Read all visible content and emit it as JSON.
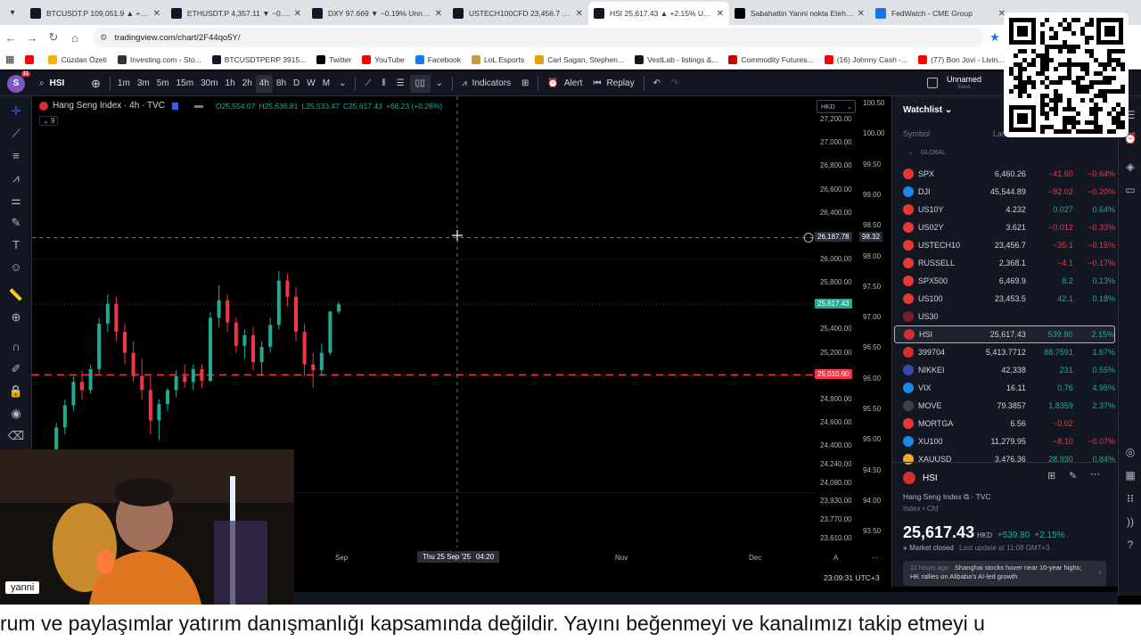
{
  "browser": {
    "tabs": [
      {
        "title": "BTCUSDT.P 109,051.9 ▲ +0.78%",
        "fav_color": "#131722",
        "active": false
      },
      {
        "title": "ETHUSDT.P 4,357.11 ▼ −0.74%",
        "fav_color": "#131722",
        "active": false
      },
      {
        "title": "DXY 97.669 ▼ −0.19% Unnamed",
        "fav_color": "#131722",
        "active": false
      },
      {
        "title": "USTECH100CFD 23,456.7 ▼ −0",
        "fav_color": "#131722",
        "active": false
      },
      {
        "title": "HSI 25,617.43 ▲ +2.15% Unnamed",
        "fav_color": "#131722",
        "active": true
      },
      {
        "title": "Sabahattin Yanni nokta Etehe (",
        "fav_color": "#000000",
        "active": false
      },
      {
        "title": "FedWatch - CME Group",
        "fav_color": "#1a73e8",
        "active": false
      }
    ],
    "url": "tradingview.com/chart/2F44qo5Y/",
    "bookmarks": [
      {
        "label": "",
        "color": "#ff0000"
      },
      {
        "label": "Cüzdan Özeti",
        "color": "#f4b400"
      },
      {
        "label": "Investing.com - Sto...",
        "color": "#333333"
      },
      {
        "label": "BTCUSDTPERP 3915...",
        "color": "#131722"
      },
      {
        "label": "Twitter",
        "color": "#000000"
      },
      {
        "label": "YouTube",
        "color": "#ff0000"
      },
      {
        "label": "Facebook",
        "color": "#1877f2"
      },
      {
        "label": "LoL Esports",
        "color": "#c89b3c"
      },
      {
        "label": "Carl Sagan, Stephen...",
        "color": "#e5a00d"
      },
      {
        "label": "VestLab - listings &...",
        "color": "#131722"
      },
      {
        "label": "Commodity Futures...",
        "color": "#cc0000"
      },
      {
        "label": "(16) Johnny Cash -...",
        "color": "#ff0000"
      },
      {
        "label": "(77) Bon Jovi - Livin...",
        "color": "#ff0000"
      }
    ]
  },
  "toolbar": {
    "avatar_letter": "S",
    "avatar_badge": "11",
    "symbol": "HSI",
    "intervals": [
      "1m",
      "3m",
      "5m",
      "15m",
      "30m",
      "1h",
      "2h",
      "4h",
      "8h",
      "D",
      "W",
      "M"
    ],
    "active_interval": "4h",
    "indicators_label": "Indicators",
    "alert_label": "Alert",
    "replay_label": "Replay",
    "layout_name": "Unnamed",
    "layout_sub": "Save"
  },
  "chart": {
    "title": "Hang Seng Index · 4h · TVC",
    "ohlc": {
      "o": "O25,554.07",
      "h": "H25,636.81",
      "l": "L25,533.47",
      "c": "C25,617.43",
      "chg": "+66.23 (+0.26%)"
    },
    "indicator_count": "9",
    "currency": "HKD",
    "price_ticks": [
      "27,200.00",
      "27,000.00",
      "26,800.00",
      "26,600.00",
      "26,400.00",
      "26,000.00",
      "25,800.00",
      "25,600.00",
      "25,400.00",
      "25,200.00",
      "24,800.00",
      "24,600.00",
      "24,400.00",
      "24,240.00",
      "24,080.00",
      "23,930.00",
      "23,770.00",
      "23,610.00"
    ],
    "dxy_ticks": [
      "100.50",
      "100.00",
      "99.50",
      "99.00",
      "98.50",
      "98.00",
      "97.50",
      "97.00",
      "96.50",
      "96.00",
      "95.50",
      "95.00",
      "94.50",
      "94.00",
      "93.50"
    ],
    "crosshair_price": "26,187.78",
    "crosshair_dxy": "98.32",
    "last_price": "25,617.43",
    "red_line_price": "25,010.90",
    "x_ticks": [
      "Sep",
      "Nov",
      "Dec"
    ],
    "crosshair_date": "Thu 25 Sep '25",
    "crosshair_time": "04:20",
    "timezone": "23:09:31 UTC+3",
    "scale_a": "A"
  },
  "watchlist": {
    "title": "Watchlist",
    "col_symbol": "Symbol",
    "col_last": "Last",
    "group": "GLOBAL",
    "rows": [
      {
        "sym": "SPX",
        "last": "6,460.26",
        "chg": "−41.60",
        "pct": "−0.64%",
        "dir": "down",
        "color": "#e53935"
      },
      {
        "sym": "DJI",
        "last": "45,544.89",
        "chg": "−92.02",
        "pct": "−0.20%",
        "dir": "down",
        "color": "#1e88e5"
      },
      {
        "sym": "US10Y",
        "last": "4.232",
        "chg": "0.027",
        "pct": "0.64%",
        "dir": "up",
        "color": "#e53935"
      },
      {
        "sym": "US02Y",
        "last": "3.621",
        "chg": "−0.012",
        "pct": "−0.33%",
        "dir": "down",
        "color": "#e53935"
      },
      {
        "sym": "USTECH10",
        "last": "23,456.7",
        "chg": "−35.1",
        "pct": "−0.15%",
        "dir": "down",
        "color": "#e53935"
      },
      {
        "sym": "RUSSELL",
        "last": "2,368.1",
        "chg": "−4.1",
        "pct": "−0.17%",
        "dir": "down",
        "color": "#e53935"
      },
      {
        "sym": "SPX500",
        "last": "6,469.9",
        "chg": "8.2",
        "pct": "0.13%",
        "dir": "up",
        "color": "#e53935"
      },
      {
        "sym": "US100",
        "last": "23,453.5",
        "chg": "42.1",
        "pct": "0.18%",
        "dir": "up",
        "color": "#e53935"
      },
      {
        "sym": "US30",
        "last": "",
        "chg": "",
        "pct": "",
        "dir": "down",
        "color": "#7b1f2a"
      },
      {
        "sym": "HSI",
        "last": "25,617.43",
        "chg": "539.80",
        "pct": "2.15%",
        "dir": "up",
        "color": "#d32f2f"
      },
      {
        "sym": "399704",
        "last": "5,413.7712",
        "chg": "88.7591",
        "pct": "1.67%",
        "dir": "up",
        "color": "#d32f2f"
      },
      {
        "sym": "NIKKEI",
        "last": "42,338",
        "chg": "231",
        "pct": "0.55%",
        "dir": "up",
        "color": "#3949ab"
      },
      {
        "sym": "VIX",
        "last": "16.11",
        "chg": "0.76",
        "pct": "4.95%",
        "dir": "up",
        "color": "#1e88e5"
      },
      {
        "sym": "MOVE",
        "last": "79.3857",
        "chg": "1.8359",
        "pct": "2.37%",
        "dir": "up",
        "color": "#424242"
      },
      {
        "sym": "MORTGA",
        "last": "6.56",
        "chg": "−0.02",
        "pct": "",
        "dir": "down",
        "color": "#e53935"
      },
      {
        "sym": "XU100",
        "last": "11,279.95",
        "chg": "−8.10",
        "pct": "−0.07%",
        "dir": "down",
        "color": "#1e88e5"
      },
      {
        "sym": "XAUUSD",
        "last": "3,476.36",
        "chg": "28.930",
        "pct": "0.84%",
        "dir": "up",
        "color": "#f9a825"
      }
    ]
  },
  "details": {
    "symbol": "HSI",
    "name": "Hang Seng Index",
    "exchange": "TVC",
    "type": "Index • Cfd",
    "price": "25,617.43",
    "currency": "HKD",
    "change": "+539.80",
    "change_pct": "+2.15%",
    "status": "Market closed",
    "update": "Last update at 11:08 GMT+3",
    "news_time": "11 hours ago",
    "news_text": "Shanghai stocks hover near 10-year highs; HK rallies on Alibaba's AI-led growth"
  },
  "webcam": {
    "name": "yanni"
  },
  "ticker": {
    "text": "rum ve paylaşımlar yatırım danışmanlığı kapsamında değildir. Yayını beğenmeyi ve kanalımızı takip etmeyi u"
  },
  "chart_data": {
    "type": "candlestick",
    "series": [
      {
        "name": "Hang Seng Index",
        "values": [
          [
            24150,
            24300,
            24050,
            24260
          ],
          [
            24260,
            24350,
            24180,
            24220
          ],
          [
            24220,
            24600,
            24200,
            24560
          ],
          [
            24560,
            24800,
            24500,
            24750
          ],
          [
            24750,
            25000,
            24700,
            24950
          ],
          [
            24950,
            25050,
            24800,
            24880
          ],
          [
            24880,
            25100,
            24850,
            25060
          ],
          [
            25060,
            25500,
            25020,
            25450
          ],
          [
            25450,
            25700,
            25380,
            25620
          ],
          [
            25620,
            25680,
            25300,
            25380
          ],
          [
            25380,
            25450,
            25100,
            25200
          ],
          [
            25200,
            25300,
            24950,
            25000
          ],
          [
            25000,
            25150,
            24800,
            24880
          ],
          [
            24880,
            25000,
            24500,
            24620
          ],
          [
            24620,
            24800,
            24450,
            24760
          ],
          [
            24760,
            24900,
            24700,
            24880
          ],
          [
            24880,
            25050,
            24820,
            25000
          ],
          [
            25000,
            25100,
            24900,
            24950
          ],
          [
            24950,
            25100,
            24880,
            25060
          ],
          [
            25060,
            25100,
            24900,
            24960
          ],
          [
            24960,
            25550,
            24950,
            25500
          ],
          [
            25500,
            25780,
            25420,
            25650
          ],
          [
            25650,
            25700,
            25380,
            25460
          ],
          [
            25460,
            25500,
            25200,
            25260
          ],
          [
            25260,
            25400,
            25150,
            25350
          ],
          [
            25350,
            25420,
            25050,
            25120
          ],
          [
            25120,
            25300,
            25000,
            25250
          ],
          [
            25250,
            25500,
            25200,
            25440
          ],
          [
            25440,
            25900,
            25400,
            25820
          ],
          [
            25820,
            25880,
            25600,
            25680
          ],
          [
            25680,
            25760,
            25300,
            25380
          ],
          [
            25380,
            25450,
            25000,
            25100
          ],
          [
            25100,
            25200,
            24900,
            25050
          ],
          [
            25050,
            25280,
            25000,
            25200
          ],
          [
            25200,
            25560,
            25180,
            25554
          ],
          [
            25554,
            25637,
            25533,
            25617
          ]
        ]
      }
    ],
    "ylim": [
      23530,
      27400
    ],
    "hlines": [
      25010.9,
      26187.78
    ]
  }
}
